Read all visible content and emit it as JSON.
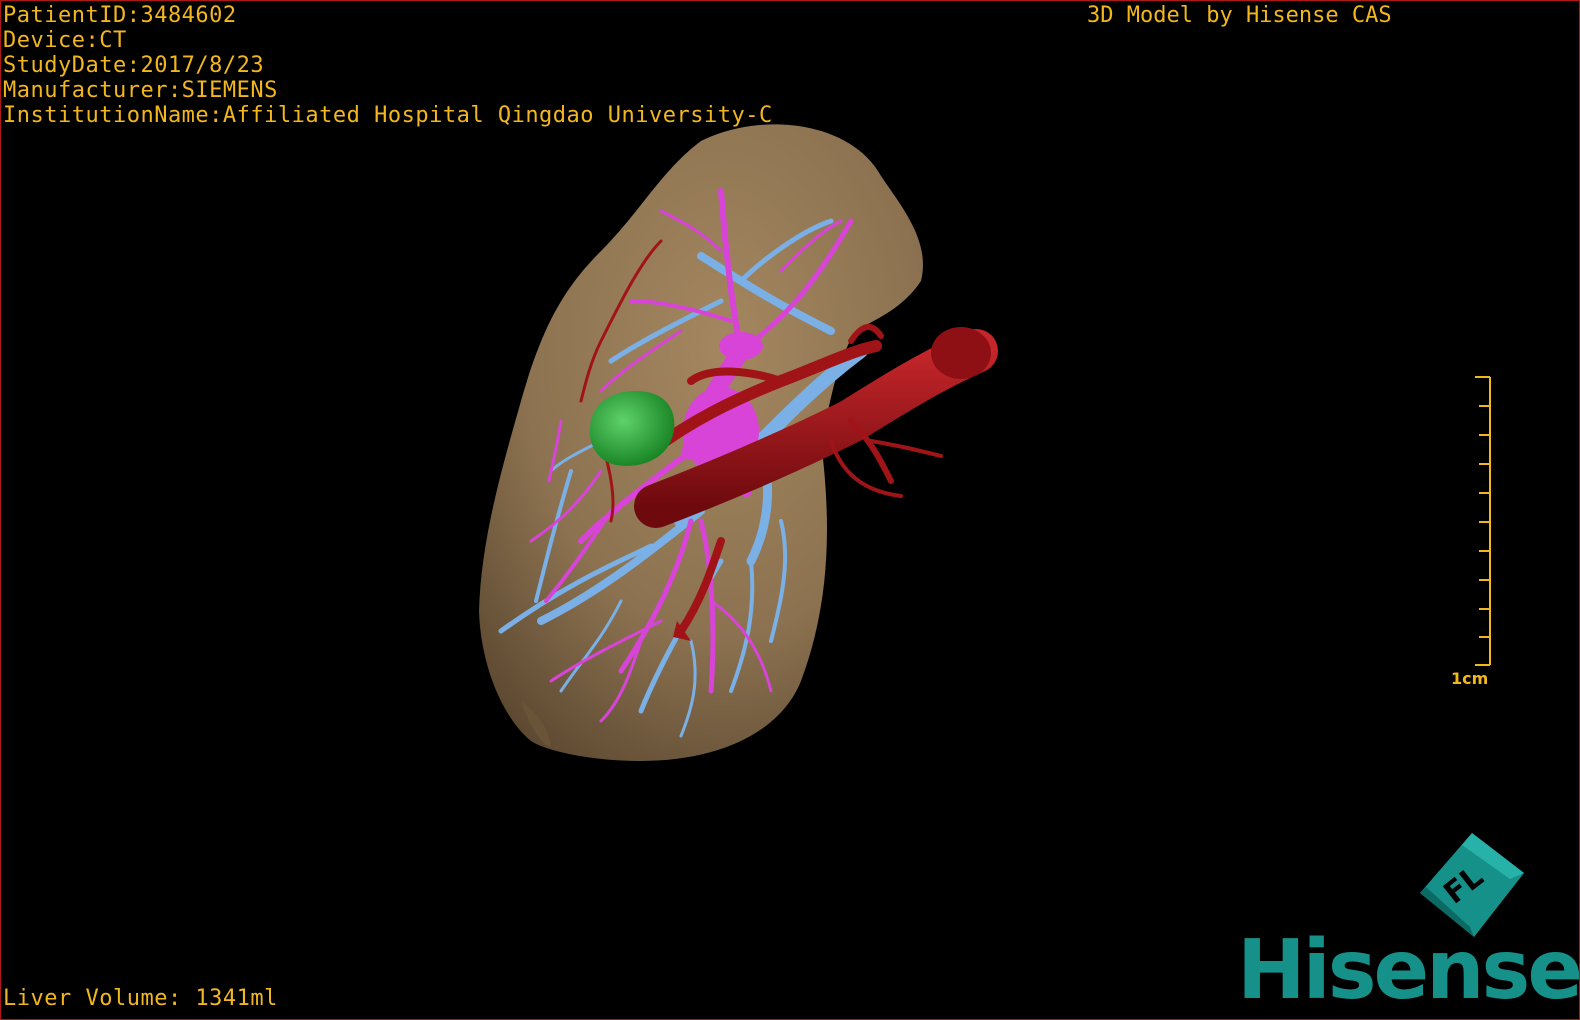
{
  "overlay": {
    "patient_id": "PatientID:3484602",
    "device": "Device:CT",
    "study_date": "StudyDate:2017/8/23",
    "manufacturer": "Manufacturer:SIEMENS",
    "institution": "InstitutionName:Affiliated Hospital Qingdao University-C",
    "model_credit": "3D Model by Hisense CAS",
    "liver_volume": "Liver Volume: 1341ml"
  },
  "scale": {
    "label": "1cm"
  },
  "brand": {
    "name": "Hisense",
    "mark_text": "FL"
  },
  "colors": {
    "overlay_text": "#f2b71c",
    "liver": "#8c7250",
    "portal_vein": "#7ab0e6",
    "hepatic_vein": "#d844d8",
    "artery": "#a01418",
    "tumor": "#1e9a2a",
    "brand": "#16918a",
    "border": "#b01818"
  }
}
